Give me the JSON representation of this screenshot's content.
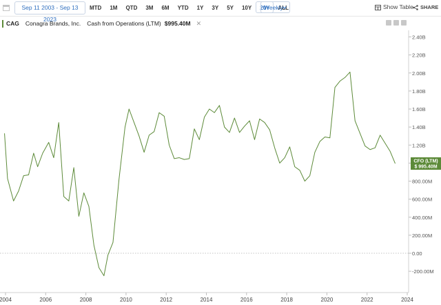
{
  "toolbar": {
    "date_range": "Sep 11 2003 - Sep 13 2023",
    "periods": [
      "MTD",
      "1M",
      "QTD",
      "3M",
      "6M",
      "YTD",
      "1Y",
      "3Y",
      "5Y",
      "10Y",
      "20Y",
      "ALL"
    ],
    "active_period": "20Y",
    "frequency": "Weekly",
    "show_table": "Show Table",
    "share": "SHARE"
  },
  "legend": {
    "ticker": "CAG",
    "company": "Conagra Brands, Inc.",
    "metric": "Cash from Operations (LTM)",
    "value": "$995.40M"
  },
  "colors": {
    "line": "#5c8a38",
    "accent": "#2f6fbf"
  },
  "chart_data": {
    "type": "line",
    "title": "",
    "xlabel": "",
    "ylabel": "",
    "xlim": [
      2004.0,
      2024.0
    ],
    "ylim": [
      -260,
      2400
    ],
    "grid": false,
    "x_tick_labels": [
      "2004",
      "2006",
      "2008",
      "2010",
      "2012",
      "2014",
      "2016",
      "2018",
      "2020",
      "2022",
      "2024"
    ],
    "x_ticks": [
      2004,
      2006,
      2008,
      2010,
      2012,
      2014,
      2016,
      2018,
      2020,
      2022,
      2024
    ],
    "y_tick_labels": [
      "-200.00M",
      "0.00",
      "200.00M",
      "400.00M",
      "600.00M",
      "800.00M",
      "1.00B",
      "1.20B",
      "1.40B",
      "1.60B",
      "1.80B",
      "2.00B",
      "2.20B",
      "2.40B"
    ],
    "y_ticks": [
      -200,
      0,
      200,
      400,
      600,
      800,
      1000,
      1200,
      1400,
      1600,
      1800,
      2000,
      2200,
      2400
    ],
    "units": "millions USD",
    "end_label": {
      "name": "CFO (LTM)",
      "value": "$ 995.40M",
      "y": 995.4
    },
    "series": [
      {
        "name": "CFO (LTM)",
        "x": [
          2003.95,
          2004.1,
          2004.4,
          2004.65,
          2004.9,
          2005.15,
          2005.4,
          2005.6,
          2005.85,
          2006.15,
          2006.4,
          2006.65,
          2006.9,
          2007.15,
          2007.4,
          2007.65,
          2007.9,
          2008.15,
          2008.4,
          2008.65,
          2008.9,
          2009.1,
          2009.35,
          2009.65,
          2009.95,
          2010.15,
          2010.4,
          2010.65,
          2010.9,
          2011.15,
          2011.4,
          2011.65,
          2011.9,
          2012.15,
          2012.4,
          2012.65,
          2012.9,
          2013.15,
          2013.4,
          2013.65,
          2013.9,
          2014.15,
          2014.4,
          2014.65,
          2014.9,
          2015.15,
          2015.4,
          2015.65,
          2015.9,
          2016.15,
          2016.4,
          2016.65,
          2016.9,
          2017.15,
          2017.4,
          2017.65,
          2017.9,
          2018.15,
          2018.4,
          2018.65,
          2018.9,
          2019.15,
          2019.4,
          2019.65,
          2019.9,
          2020.15,
          2020.4,
          2020.65,
          2020.9,
          2021.15,
          2021.4,
          2021.65,
          2021.9,
          2022.15,
          2022.4,
          2022.65,
          2022.9,
          2023.15,
          2023.4
        ],
        "values": [
          1330,
          830,
          580,
          690,
          860,
          870,
          1110,
          960,
          1110,
          1230,
          1060,
          1450,
          630,
          580,
          950,
          410,
          670,
          520,
          90,
          -160,
          -250,
          -20,
          120,
          820,
          1400,
          1600,
          1450,
          1300,
          1120,
          1310,
          1350,
          1560,
          1520,
          1200,
          1050,
          1060,
          1040,
          1050,
          1380,
          1260,
          1510,
          1600,
          1560,
          1640,
          1400,
          1340,
          1500,
          1340,
          1410,
          1470,
          1260,
          1490,
          1450,
          1370,
          1170,
          1000,
          1060,
          1180,
          960,
          920,
          800,
          860,
          1120,
          1240,
          1290,
          1280,
          1840,
          1910,
          1950,
          2010,
          1470,
          1330,
          1190,
          1150,
          1170,
          1310,
          1220,
          1130,
          995.4
        ]
      }
    ]
  }
}
